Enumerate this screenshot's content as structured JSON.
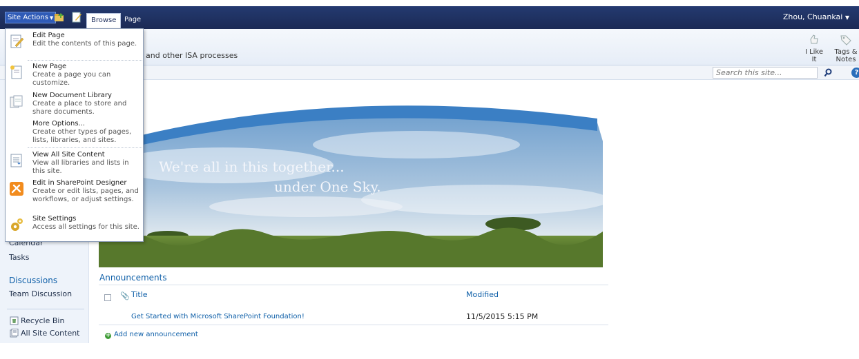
{
  "ribbon": {
    "site_actions_label": "Site Actions",
    "tabs": [
      {
        "label": "Browse"
      },
      {
        "label": "Page"
      }
    ],
    "user_name": "Zhou, Chuankai"
  },
  "title_area": {
    "description": "and other ISA processes",
    "like_label": "I Like It",
    "tags_label": "Tags &",
    "tags_label2": "Notes"
  },
  "search": {
    "placeholder": "Search this site..."
  },
  "menu": {
    "items": [
      {
        "title": "Edit Page",
        "desc": "Edit the contents of this page.",
        "icon": "edit-page-icon"
      },
      {
        "title": "New Page",
        "desc": "Create a page you can customize.",
        "icon": "new-page-icon"
      },
      {
        "title": "New Document Library",
        "desc": "Create a place to store and share documents.",
        "icon": "new-library-icon"
      },
      {
        "title": "More Options...",
        "desc": "Create other types of pages, lists, libraries, and sites.",
        "icon": ""
      },
      {
        "title": "View All Site Content",
        "desc": "View all libraries and lists in this site.",
        "icon": "site-content-icon"
      },
      {
        "title": "Edit in SharePoint Designer",
        "desc": "Create or edit lists, pages, and workflows, or adjust settings.",
        "icon": "sharepoint-designer-icon"
      },
      {
        "title": "Site Settings",
        "desc": "Access all settings for this site.",
        "icon": "settings-gear-icon"
      }
    ]
  },
  "left_nav": {
    "calendar": "Calendar",
    "tasks": "Tasks",
    "discussions_header": "Discussions",
    "team_discussion": "Team Discussion",
    "recycle_bin": "Recycle Bin",
    "all_site_content": "All Site Content"
  },
  "banner": {
    "line1": "We're all in this together...",
    "line2": "under One Sky."
  },
  "announcements": {
    "title": "Announcements",
    "col_title": "Title",
    "col_modified": "Modified",
    "rows": [
      {
        "title": "Get Started with Microsoft SharePoint Foundation!",
        "modified": "11/5/2015 5:15 PM"
      }
    ],
    "add_new": "Add new announcement"
  }
}
